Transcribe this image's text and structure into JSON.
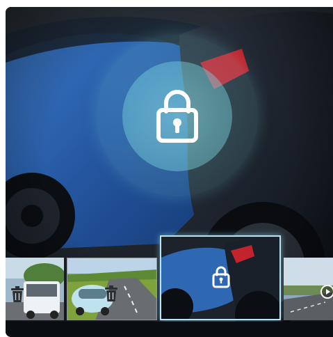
{
  "viewer": {
    "main_view": "locked-crash-recording",
    "overlay_icon": "lock-icon"
  },
  "thumbnails": [
    {
      "name": "thumbnail-van",
      "icon": "trash-icon",
      "selected": false
    },
    {
      "name": "thumbnail-road-car",
      "icon": "trash-icon",
      "selected": false
    },
    {
      "name": "thumbnail-crash",
      "icon": "lock-icon",
      "selected": true
    },
    {
      "name": "thumbnail-highway",
      "icon": "play-icon",
      "selected": false
    }
  ],
  "colors": {
    "lock_ring": "#8fe3e8",
    "lock_glyph": "#ffffff",
    "selected_border": "#b9e6f6",
    "frame_background": "#0c1016"
  }
}
